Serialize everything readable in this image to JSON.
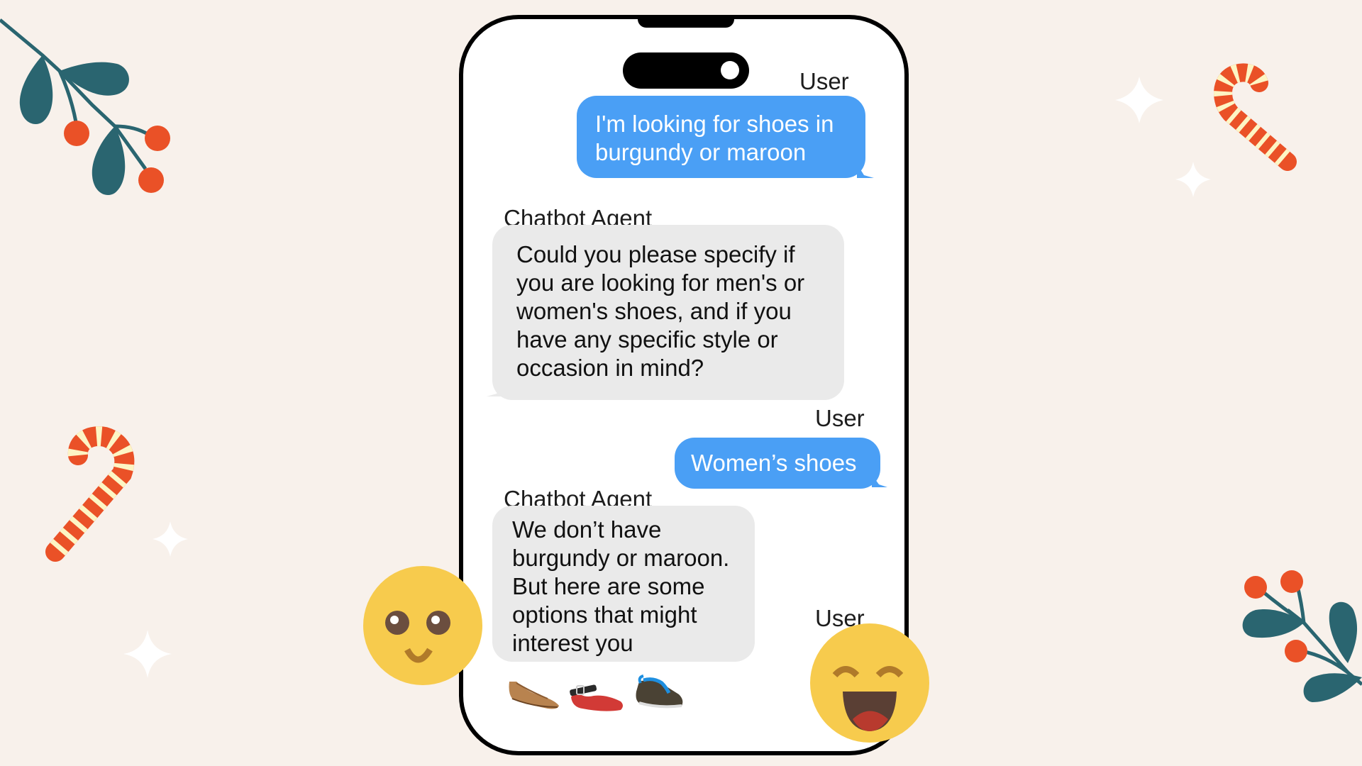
{
  "phone": {
    "messages": [
      {
        "sender": "User",
        "text_lines": [
          "I'm looking for shoes in",
          "burgundy or maroon"
        ],
        "role": "user"
      },
      {
        "sender": "Chatbot Agent",
        "text_lines": [
          "Could you please specify if",
          "you are looking for men's or",
          "women's shoes, and if you",
          "have any specific style or",
          "occasion in mind?"
        ],
        "role": "agent"
      },
      {
        "sender": "User",
        "text_lines": [
          "Women’s shoes"
        ],
        "role": "user"
      },
      {
        "sender": "Chatbot Agent",
        "text_lines": [
          "We don’t have",
          "burgundy or maroon.",
          "But here are some",
          "options that might",
          "interest you"
        ],
        "role": "agent"
      },
      {
        "sender": "User",
        "text_lines": [],
        "role": "user"
      }
    ],
    "product_images": [
      {
        "icon": "tan-ballet-flat-shoe"
      },
      {
        "icon": "red-mary-jane-shoe"
      },
      {
        "icon": "brown-blue-sneaker-shoe"
      }
    ]
  },
  "decorations": {
    "emojis": [
      "smiling-face-emoji",
      "grinning-face-emoji"
    ],
    "items": [
      "holly-branch",
      "candy-cane",
      "sparkle"
    ]
  },
  "colors": {
    "background": "#F8F1EB",
    "user_bubble": "#4A9FF5",
    "agent_bubble": "#EAEAEA",
    "berry": "#EA5127",
    "leaf": "#2A6570",
    "emoji": "#F7CB4D"
  }
}
